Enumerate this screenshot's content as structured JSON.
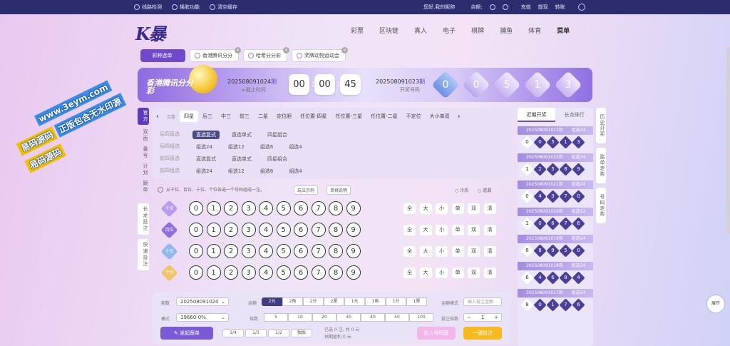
{
  "topbar": {
    "line_check": "线路检测",
    "skin": "换肤功能",
    "clear_cache": "清空缓存",
    "greeting": "您好,",
    "nickname": "我的昵称",
    "balance_label": "余额:",
    "recharge": "充值",
    "withdraw": "提现",
    "transfer": "转账"
  },
  "nav": {
    "logo": "K暴",
    "menu": [
      "彩票",
      "区块链",
      "真人",
      "电子",
      "棋牌",
      "捕鱼",
      "体育",
      "菜单"
    ]
  },
  "tabs": [
    {
      "label": "彩种选单",
      "active": true
    },
    {
      "label": "香港腾讯分分"
    },
    {
      "label": "哈希分分彩"
    },
    {
      "label": "奖牌动物运动会"
    }
  ],
  "banner": {
    "game_name": "香港腾讯分分彩",
    "current_issue": "202508091024",
    "issue_suffix": "期",
    "stop_label": "截止时间",
    "time": [
      "00",
      "00",
      "45"
    ],
    "last_issue": "202508091023",
    "open_label": "开奖号码",
    "numbers": [
      "0",
      "0",
      "5",
      "1",
      "3"
    ]
  },
  "vnav": [
    {
      "label": "官方",
      "active": true
    },
    {
      "label": "双面"
    },
    {
      "label": "番号"
    },
    {
      "label": "计划"
    },
    {
      "label": "跟单"
    },
    {
      "label": "长龙投注"
    },
    {
      "label": "快速投注"
    }
  ],
  "play_tabs": [
    "足趣",
    "四星",
    "后三",
    "中三",
    "前三",
    "二星",
    "定位胆",
    "任位置-四星",
    "任位置-三星",
    "任位置-二星",
    "不定位",
    "大小单双"
  ],
  "sub_rows": [
    {
      "head": "后四直选",
      "items": [
        "直选复式",
        "直选单式",
        "四星组合"
      ],
      "active": 0
    },
    {
      "head": "后四组选",
      "items": [
        "组选24",
        "组选12",
        "组选6",
        "组选4"
      ]
    },
    {
      "head": "前四直选",
      "items": [
        "直选复式",
        "直选单式",
        "四星组合"
      ]
    },
    {
      "head": "前四组选",
      "items": [
        "组选24",
        "组选12",
        "组选6",
        "组选4"
      ]
    }
  ],
  "hint": {
    "text": "从千位、百位、十位、个位各选一个号码组成一注。",
    "example": "玩法示例",
    "explain": "单挑说明",
    "cold": "冷热",
    "miss": "遗漏"
  },
  "rows": [
    {
      "label": "千位",
      "color": "#b69cf0"
    },
    {
      "label": "百位",
      "color": "#8f6fe0"
    },
    {
      "label": "十位",
      "color": "#8fb8ee"
    },
    {
      "label": "个位",
      "color": "#f1c36a"
    }
  ],
  "digits": [
    "0",
    "1",
    "2",
    "3",
    "4",
    "5",
    "6",
    "7",
    "8",
    "9"
  ],
  "quick": [
    "全",
    "大",
    "小",
    "单",
    "双",
    "清"
  ],
  "bottom": {
    "issue_label": "期数",
    "issue_value": "202508091024",
    "amount_label": "金额",
    "amounts": [
      "2元",
      "2角",
      "2分",
      "2厘",
      "1元",
      "1角",
      "1分",
      "1厘"
    ],
    "total_label": "金额模式",
    "total_placeholder": "输入投注金额",
    "mode_label": "模式",
    "mode_value": "19660-0%",
    "multiple_label": "倍数",
    "multiples": [
      "5",
      "10",
      "20",
      "30",
      "40",
      "50",
      "100"
    ],
    "count_label": "投注倍数",
    "count_value": "1",
    "minus": "−",
    "plus": "+",
    "bet_button": "发起跟单",
    "fractions": [
      "1/4",
      "1/3",
      "1/2",
      "独胎"
    ],
    "selected": "已选",
    "bets": "0",
    "bets_unit": "注,",
    "total": "共",
    "total_value": "0",
    "yuan": "元",
    "profit": "预期盈利",
    "profit_value": "0",
    "profit_unit": "元",
    "add_button": "加入号码篮",
    "submit_button": "一键投注"
  },
  "right": {
    "tab_recent": "近期开奖",
    "tab_rank": "长龙排行",
    "draws": [
      {
        "issue": "202508091023",
        "suffix": "期",
        "type": "组选24",
        "balls": [
          "0",
          "0",
          "5",
          "1",
          "3"
        ]
      },
      {
        "issue": "202508091022",
        "suffix": "期",
        "type": "组选24",
        "balls": [
          "1",
          "2",
          "5",
          "8",
          "9"
        ]
      },
      {
        "issue": "202508091021",
        "suffix": "期",
        "type": "组选24",
        "balls": [
          "0",
          "4",
          "3",
          "7",
          "0"
        ]
      },
      {
        "issue": "202508091020",
        "suffix": "期",
        "type": "组选12",
        "balls": [
          "1",
          "0",
          "6",
          "7",
          "6"
        ]
      },
      {
        "issue": "202508091019",
        "suffix": "期",
        "type": "组选24",
        "balls": [
          "8",
          "8",
          "9",
          "5",
          "0"
        ]
      },
      {
        "issue": "202508091018",
        "suffix": "期",
        "type": "组选24",
        "balls": [
          "6",
          "4",
          "6",
          "8",
          "4"
        ]
      },
      {
        "issue": "202508091017",
        "suffix": "期",
        "type": "组选24",
        "balls": [
          "8",
          "0",
          "1",
          "7",
          "6"
        ]
      }
    ]
  },
  "rside": [
    "历史开奖",
    "路单走势",
    "号码走势"
  ],
  "watermark": {
    "line1": "www.3eym.com",
    "line2": "易码源码",
    "line3": "正版包含无水印源",
    "line4": "易码源码"
  },
  "fab": "展开"
}
